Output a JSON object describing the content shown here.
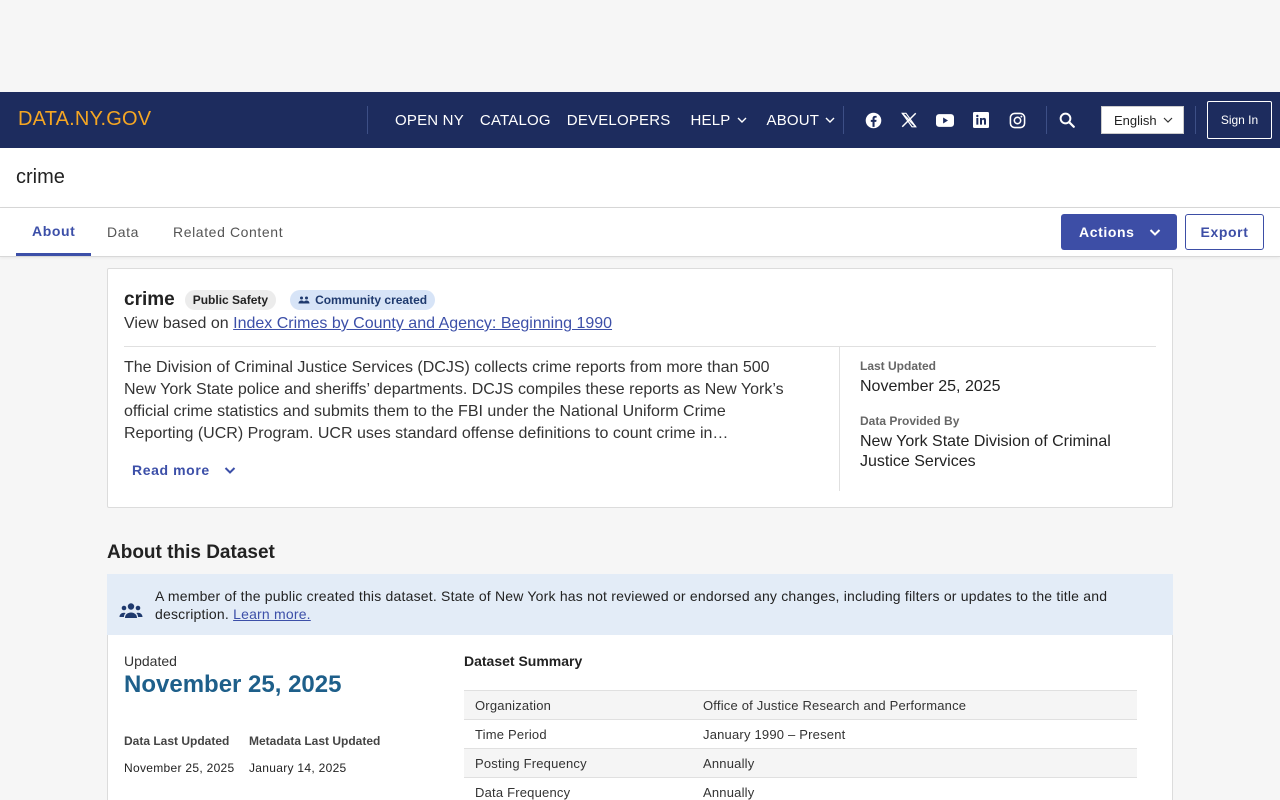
{
  "brand": "DATA.NY.GOV",
  "nav": {
    "links": [
      {
        "label": "OPEN NY"
      },
      {
        "label": "CATALOG"
      },
      {
        "label": "DEVELOPERS"
      },
      {
        "label": "HELP"
      },
      {
        "label": "ABOUT"
      }
    ],
    "socials": [
      "facebook-icon",
      "x-icon",
      "youtube-icon",
      "linkedin-icon",
      "instagram-icon"
    ],
    "language": "English",
    "sign_in": "Sign In"
  },
  "page_title": "crime",
  "tabs": [
    {
      "label": "About",
      "active": true
    },
    {
      "label": "Data"
    },
    {
      "label": "Related Content"
    }
  ],
  "toolbar": {
    "actions_label": "Actions",
    "export_label": "Export"
  },
  "card": {
    "title": "crime",
    "category_badge": "Public Safety",
    "community_badge": "Community created",
    "view_based_prefix": "View based on",
    "view_based_link": "Index Crimes by County and Agency: Beginning 1990",
    "description": "The Division of Criminal Justice Services (DCJS) collects crime reports from more than 500 New York State police and sheriffs’ departments. DCJS compiles these reports as New York’s official crime statistics and submits them to the FBI under the National Uniform Crime Reporting (UCR) Program. UCR uses standard offense definitions to count crime in…",
    "read_more": "Read more",
    "last_updated_label": "Last Updated",
    "last_updated_value": "November 25, 2025",
    "provided_by_label": "Data Provided By",
    "provided_by_value": "New York State Division of Criminal Justice Services"
  },
  "about": {
    "heading": "About this Dataset",
    "notice_text": "A member of the public created this dataset. State of New York has not reviewed or endorsed any changes, including filters or updates to the title and description.",
    "notice_link": "Learn more.",
    "updated_label": "Updated",
    "updated_value": "November 25, 2025",
    "data_last_updated_label": "Data Last Updated",
    "data_last_updated_value": "November 25, 2025",
    "metadata_last_updated_label": "Metadata Last Updated",
    "metadata_last_updated_value": "January 14, 2025",
    "summary_title": "Dataset Summary",
    "summary_rows": [
      {
        "key": "Organization",
        "value": "Office of Justice Research and Performance"
      },
      {
        "key": "Time Period",
        "value": "January 1990 – Present"
      },
      {
        "key": "Posting Frequency",
        "value": "Annually"
      },
      {
        "key": "Data Frequency",
        "value": "Annually"
      }
    ]
  },
  "colors": {
    "nav_bg": "#1d2c5e",
    "brand": "#f5a623",
    "accent": "#3d4ea6",
    "date_accent": "#1e5f8a"
  }
}
